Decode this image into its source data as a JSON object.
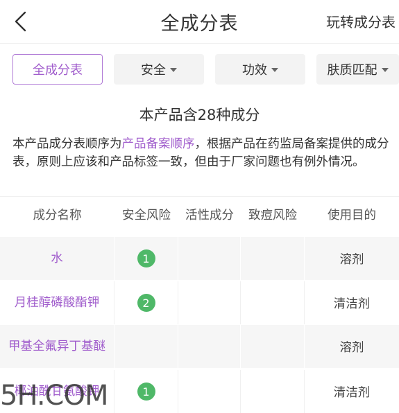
{
  "nav": {
    "title": "全成分表",
    "right_link": "玩转成分表"
  },
  "filters": [
    {
      "label": "全成分表",
      "active": true,
      "dropdown": false
    },
    {
      "label": "安全",
      "active": false,
      "dropdown": true
    },
    {
      "label": "功效",
      "active": false,
      "dropdown": true
    },
    {
      "label": "肤质匹配",
      "active": false,
      "dropdown": true
    }
  ],
  "summary": {
    "heading": "本产品含28种成分",
    "desc_prefix": "本产品成分表顺序为",
    "desc_link": "产品备案顺序",
    "desc_suffix": "，根据产品在药监局备案提供的成分表，原则上应该和产品标签一致，但由于厂家问题也有例外情况。"
  },
  "table": {
    "headers": [
      "成分名称",
      "安全风险",
      "活性成分",
      "致痘风险",
      "使用目的"
    ],
    "rows": [
      {
        "name": "水",
        "risk": "1",
        "purpose": "溶剂"
      },
      {
        "name": "月桂醇磷酸酯钾",
        "risk": "2",
        "purpose": "清洁剂"
      },
      {
        "name": "甲基全氟异丁基醚",
        "risk": "",
        "purpose": "溶剂"
      },
      {
        "name": "椰油酰甘氨酸钾",
        "risk": "1",
        "purpose": "清洁剂"
      }
    ]
  },
  "watermark": "5H.COM",
  "colors": {
    "accent": "#a05ccc",
    "badge_green": "#4fb868"
  }
}
